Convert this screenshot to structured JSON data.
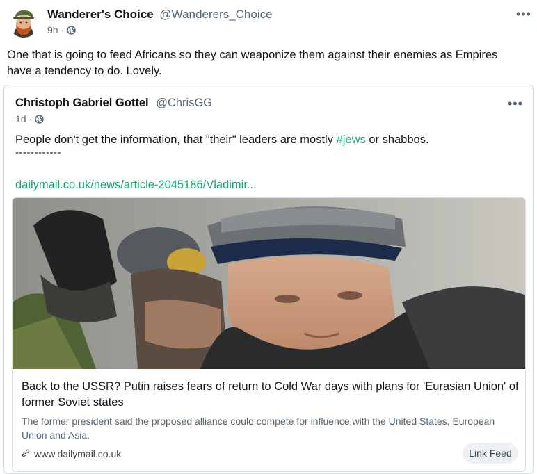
{
  "post": {
    "author_name": "Wanderer's Choice",
    "author_handle": "@Wanderers_Choice",
    "time": "9h",
    "dot": "·",
    "visibility_icon": "globe-icon",
    "more_icon": "more-dots-icon",
    "more_label": "•••",
    "text": "One that is going to feed Africans so they can weaponize them against their enemies as Empires have a tendency to do. Lovely."
  },
  "quote": {
    "author_name": "Christoph Gabriel Gottel",
    "author_handle": "@ChrisGG",
    "time": "1d",
    "dot": "·",
    "visibility_icon": "globe-icon",
    "more_label": "•••",
    "text_before": "People don't get the information, that \"their\" leaders are mostly ",
    "hashtag": "#jews",
    "text_after": " or shabbos.",
    "separator": "------------",
    "link_text": "dailymail.co.uk/news/article-2045186/Vladimir...",
    "card": {
      "title": "Back to the USSR? Putin raises fears of return to Cold War days with plans for 'Eurasian Union' of former Soviet states",
      "description": "The former president said the proposed alliance could compete for influence with the United States, European Union and Asia.",
      "domain_icon": "link-icon",
      "domain": "www.dailymail.co.uk",
      "button_label": "Link Feed"
    }
  },
  "colors": {
    "accent_link": "#1aa36b",
    "muted_text": "#536471",
    "border": "#cfd9de"
  }
}
